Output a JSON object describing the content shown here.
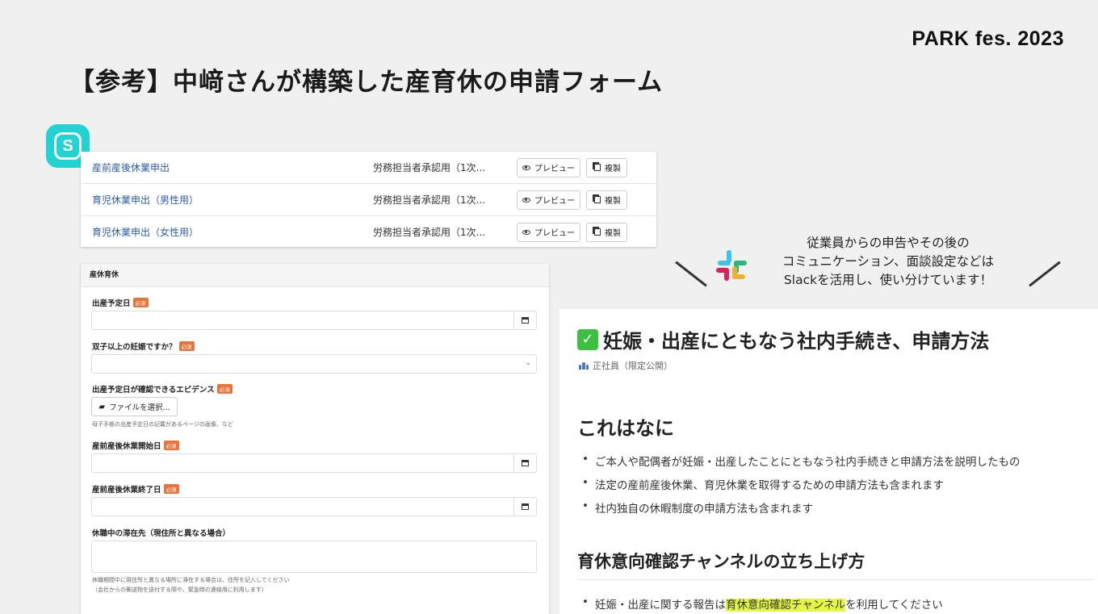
{
  "brand": "PARK fes. 2023",
  "slide_title": "【参考】中﨑さんが構築した産育休の申請フォーム",
  "app_logo_letter": "S",
  "forms": [
    {
      "name": "産前産後休業申出",
      "approver": "労務担当者承認用（1次...",
      "preview": "プレビュー",
      "copy": "複製"
    },
    {
      "name": "育児休業申出（男性用）",
      "approver": "労務担当者承認用（1次...",
      "preview": "プレビュー",
      "copy": "複製"
    },
    {
      "name": "育児休業申出（女性用）",
      "approver": "労務担当者承認用（1次...",
      "preview": "プレビュー",
      "copy": "複製"
    }
  ],
  "form_panel": {
    "header": "産休育休",
    "required_badge": "必須",
    "fields": {
      "due_date": "出産予定日",
      "twins": "双子以上の妊娠ですか？",
      "evidence": "出産予定日が確認できるエビデンス",
      "file_button": "ファイルを選択...",
      "evidence_hint": "母子手帳の出産予定日の記載があるページの画像、など",
      "leave_start": "産前産後休業開始日",
      "leave_end": "産前産後休業終了日",
      "stay_address": "休職中の滞在先（現住所と異なる場合）",
      "stay_hint_1": "休職期間中に現住所と異なる場所に滞在する場合は、住所を記入してください",
      "stay_hint_2": "（会社からの郵送物を送付する際や、緊急時の連絡用に利用します）"
    }
  },
  "slack_note": {
    "line1": "従業員からの申告やその後の",
    "line2": "コミュニケーション、面談設定などは",
    "line3": "Slackを活用し、使い分けています！"
  },
  "notion": {
    "title": "妊娠・出産にともなう社内手続き、申請方法",
    "tag": "正社員（限定公開）",
    "h1": "これはなに",
    "bullets": [
      "ご本人や配偶者が妊娠・出産したことにともなう社内手続きと申請方法を説明したもの",
      "法定の産前産後休業、育児休業を取得するための申請方法も含まれます",
      "社内独自の休暇制度の申請方法も含まれます"
    ],
    "h2": "育休意向確認チャンネルの立ち上げ方",
    "last_bullet_pre": "妊娠・出産に関する報告は",
    "last_bullet_highlight": "育休意向確認チャンネル",
    "last_bullet_post": "を利用してください"
  },
  "colors": {
    "link": "#2a5db0",
    "required": "#e8743b",
    "logo": "#22d3d3",
    "highlight": "#e3f740"
  }
}
